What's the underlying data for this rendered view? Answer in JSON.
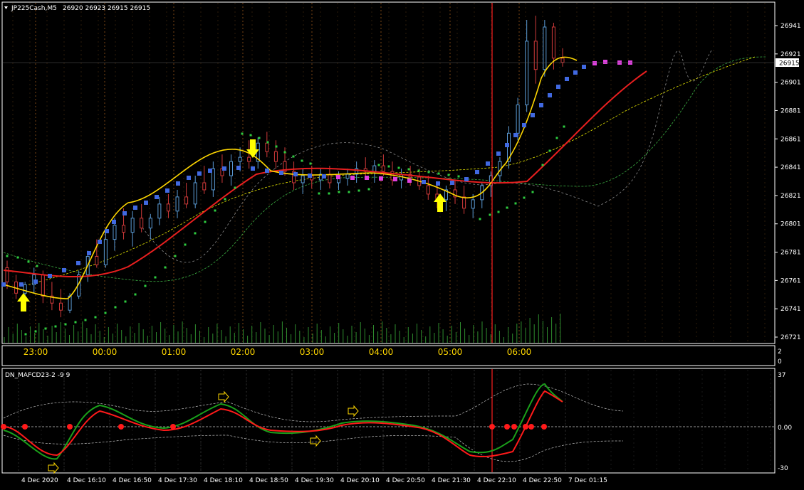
{
  "chart_header": {
    "symbol_timeframe": "JP225Cash,M5",
    "ohlc": "26920 26923 26915 26915"
  },
  "current_price_label": "26915",
  "price_axis": {
    "labels": [
      "26941",
      "26921",
      "26901",
      "26881",
      "26861",
      "26841",
      "26821",
      "26801",
      "26781",
      "26761",
      "26741",
      "26721"
    ],
    "min": 26721,
    "max": 26941
  },
  "time_axis_upper": [
    "23:00",
    "00:00",
    "01:00",
    "02:00",
    "03:00",
    "04:00",
    "05:00",
    "06:00"
  ],
  "volume_axis": [
    "2",
    "0"
  ],
  "subwindow": {
    "title": "DN_MAFCD23-2 -9 9",
    "axis_labels": [
      "37",
      "0.00",
      "-30"
    ],
    "time_axis": [
      "4 Dec 2020",
      "4 Dec 16:10",
      "4 Dec 16:50",
      "4 Dec 17:30",
      "4 Dec 18:10",
      "4 Dec 18:50",
      "4 Dec 19:30",
      "4 Dec 20:10",
      "4 Dec 20:50",
      "4 Dec 21:30",
      "4 Dec 22:10",
      "4 Dec 22:50",
      "7 Dec 01:15"
    ]
  },
  "colors": {
    "background": "#000000",
    "grid": "#c87020",
    "up_candle": "#5b9bd5",
    "down_candle": "#d13a3a",
    "ma_yellow": "#ffd700",
    "ma_red": "#e81f1f",
    "step_blue": "#4169e1",
    "dots_green": "#2ecc40",
    "volume": "#2e8b2e",
    "arrow": "#ffff00",
    "vline": "#ff2020"
  },
  "chart_data": {
    "type": "candlestick",
    "candles": [
      [
        26770,
        26775,
        26755,
        26760
      ],
      [
        26760,
        26765,
        26748,
        26752
      ],
      [
        26752,
        26760,
        26745,
        26758
      ],
      [
        26758,
        26770,
        26752,
        26765
      ],
      [
        26765,
        26768,
        26745,
        26750
      ],
      [
        26750,
        26760,
        26740,
        26745
      ],
      [
        26745,
        26755,
        26735,
        26740
      ],
      [
        26740,
        26752,
        26738,
        26750
      ],
      [
        26750,
        26768,
        26748,
        26765
      ],
      [
        26765,
        26782,
        26760,
        26778
      ],
      [
        26778,
        26790,
        26770,
        26772
      ],
      [
        26772,
        26795,
        26770,
        26790
      ],
      [
        26790,
        26805,
        26782,
        26800
      ],
      [
        26800,
        26812,
        26790,
        26795
      ],
      [
        26795,
        26810,
        26785,
        26805
      ],
      [
        26805,
        26815,
        26795,
        26798
      ],
      [
        26798,
        26808,
        26790,
        26805
      ],
      [
        26805,
        26820,
        26800,
        26815
      ],
      [
        26815,
        26822,
        26805,
        26810
      ],
      [
        26810,
        26825,
        26805,
        26820
      ],
      [
        26820,
        26830,
        26812,
        26815
      ],
      [
        26815,
        26835,
        26812,
        26830
      ],
      [
        26830,
        26842,
        26822,
        26825
      ],
      [
        26825,
        26845,
        26820,
        26840
      ],
      [
        26840,
        26850,
        26830,
        26835
      ],
      [
        26835,
        26850,
        26828,
        26845
      ],
      [
        26845,
        26855,
        26838,
        26848
      ],
      [
        26848,
        26860,
        26840,
        26845
      ],
      [
        26845,
        26862,
        26840,
        26858
      ],
      [
        26858,
        26866,
        26848,
        26852
      ],
      [
        26852,
        26860,
        26840,
        26845
      ],
      [
        26845,
        26855,
        26835,
        26838
      ],
      [
        26838,
        26845,
        26825,
        26830
      ],
      [
        26830,
        26840,
        26822,
        26835
      ],
      [
        26835,
        26842,
        26826,
        26832
      ],
      [
        26832,
        26840,
        26825,
        26836
      ],
      [
        26836,
        26842,
        26826,
        26830
      ],
      [
        26830,
        26838,
        26825,
        26833
      ],
      [
        26833,
        26840,
        26828,
        26836
      ],
      [
        26836,
        26845,
        26830,
        26840
      ],
      [
        26840,
        26848,
        26832,
        26838
      ],
      [
        26838,
        26846,
        26830,
        26842
      ],
      [
        26842,
        26850,
        26835,
        26838
      ],
      [
        26838,
        26845,
        26828,
        26832
      ],
      [
        26832,
        26840,
        26826,
        26836
      ],
      [
        26836,
        26842,
        26828,
        26834
      ],
      [
        26834,
        26840,
        26825,
        26828
      ],
      [
        26828,
        26835,
        26818,
        26822
      ],
      [
        26822,
        26830,
        26812,
        26818
      ],
      [
        26818,
        26828,
        26810,
        26825
      ],
      [
        26825,
        26832,
        26815,
        26820
      ],
      [
        26820,
        26828,
        26808,
        26812
      ],
      [
        26812,
        26822,
        26805,
        26818
      ],
      [
        26818,
        26830,
        26812,
        26828
      ],
      [
        26828,
        26838,
        26820,
        26835
      ],
      [
        26835,
        26848,
        26830,
        26845
      ],
      [
        26845,
        26870,
        26840,
        26865
      ],
      [
        26865,
        26890,
        26860,
        26885
      ],
      [
        26885,
        26945,
        26880,
        26930
      ],
      [
        26930,
        26948,
        26900,
        26910
      ],
      [
        26910,
        26945,
        26905,
        26940
      ],
      [
        26940,
        26943,
        26910,
        26918
      ],
      [
        26918,
        26925,
        26912,
        26915
      ]
    ],
    "ylim": [
      26721,
      26941
    ]
  }
}
